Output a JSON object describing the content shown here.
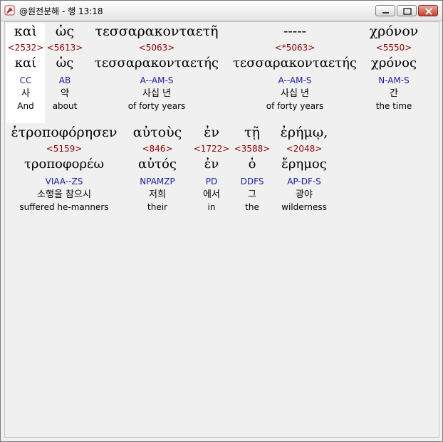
{
  "window": {
    "title": "@원전분해 - 행 13:18"
  },
  "rows": [
    [
      {
        "greek": "καὶ",
        "strong": "<2532>",
        "lemma": "καί",
        "parse": "CC",
        "korean": "사",
        "english": "And"
      },
      {
        "greek": "ὡς",
        "strong": "<5613>",
        "lemma": "ὡς",
        "parse": "AB",
        "korean": "약",
        "english": "about"
      },
      {
        "greek": "τεσσαρακονταετῆ",
        "strong": "<5063>",
        "lemma": "τεσσαρακονταετής",
        "parse": "A--AM-S",
        "korean": "사십 년",
        "english": "of forty years"
      },
      {
        "greek": "-----",
        "strong": "<*5063>",
        "lemma": "τεσσαρακονταετής",
        "parse": "A--AM-S",
        "korean": "사십 년",
        "english": "of forty years"
      },
      {
        "greek": "χρόνον",
        "strong": "<5550>",
        "lemma": "χρόνος",
        "parse": "N-AM-S",
        "korean": "간",
        "english": "the time"
      }
    ],
    [
      {
        "greek": "ἐτροποφόρησεν",
        "strong": "<5159>",
        "lemma": "τροποφορέω",
        "parse": "VIAA--ZS",
        "korean": "소행을 참으시",
        "english": "suffered he-manners"
      },
      {
        "greek": "αὐτοὺς",
        "strong": "<846>",
        "lemma": "αὐτός",
        "parse": "NPAMZP",
        "korean": "저희",
        "english": "their"
      },
      {
        "greek": "ἐν",
        "strong": "<1722>",
        "lemma": "ἐν",
        "parse": "PD",
        "korean": "에서",
        "english": "in"
      },
      {
        "greek": "τῇ",
        "strong": "<3588>",
        "lemma": "ὁ",
        "parse": "DDFS",
        "korean": "그",
        "english": "the"
      },
      {
        "greek": "ἐρήμῳ,",
        "strong": "<2048>",
        "lemma": "ἔρημος",
        "parse": "AP-DF-S",
        "korean": "광야",
        "english": "wilderness"
      }
    ]
  ]
}
